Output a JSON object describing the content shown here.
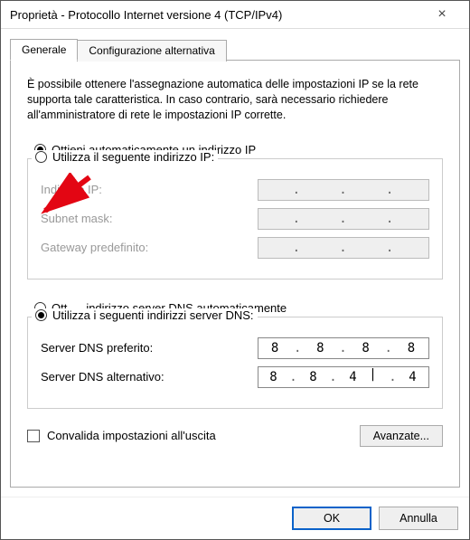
{
  "title": "Proprietà - Protocollo Internet versione 4 (TCP/IPv4)",
  "tabs": {
    "general": "Generale",
    "alt": "Configurazione alternativa"
  },
  "description": "È possibile ottenere l'assegnazione automatica delle impostazioni IP se la rete supporta tale caratteristica. In caso contrario, sarà necessario richiedere all'amministratore di rete le impostazioni IP corrette.",
  "ip_section": {
    "auto": "Ottieni automaticamente un indirizzo IP",
    "manual": "Utilizza il seguente indirizzo IP:",
    "fields": {
      "ip": "Indirizzo IP:",
      "subnet": "Subnet mask:",
      "gateway": "Gateway predefinito:"
    }
  },
  "dns_section": {
    "auto_prefix": "Ott",
    "auto_suffix": " indirizzo server DNS automaticamente",
    "manual": "Utilizza i seguenti indirizzi server DNS:",
    "pref_label": "Server DNS preferito:",
    "alt_label": "Server DNS alternativo:",
    "pref_value": [
      "8",
      "8",
      "8",
      "8"
    ],
    "alt_value": [
      "8",
      "8",
      "4",
      "4"
    ]
  },
  "validate_label": "Convalida impostazioni all'uscita",
  "advanced_label": "Avanzate...",
  "ok_label": "OK",
  "cancel_label": "Annulla"
}
